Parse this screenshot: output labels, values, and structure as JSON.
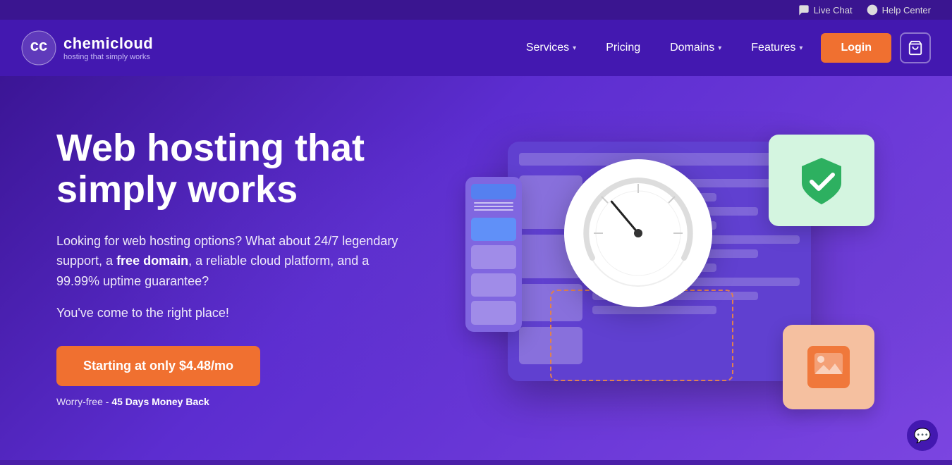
{
  "topbar": {
    "live_chat": "Live Chat",
    "help_center": "Help Center"
  },
  "nav": {
    "logo_name": "chemicloud",
    "logo_tagline": "hosting that simply works",
    "links": [
      {
        "label": "Services",
        "has_dropdown": true
      },
      {
        "label": "Pricing",
        "has_dropdown": false
      },
      {
        "label": "Domains",
        "has_dropdown": true
      },
      {
        "label": "Features",
        "has_dropdown": true
      }
    ],
    "login_label": "Login",
    "cart_aria": "Shopping Cart"
  },
  "hero": {
    "title": "Web hosting that simply works",
    "description_part1": "Looking for web hosting options? What about 24/7 legendary support, a ",
    "free_domain": "free domain",
    "description_part2": ", a reliable cloud platform, and a 99.99% uptime guarantee?",
    "tagline": "You've come to the right place!",
    "cta_label": "Starting at only $4.48/mo",
    "money_back_prefix": "Worry-free - ",
    "money_back_bold": "45 Days Money Back"
  },
  "chat": {
    "icon": "💬"
  }
}
